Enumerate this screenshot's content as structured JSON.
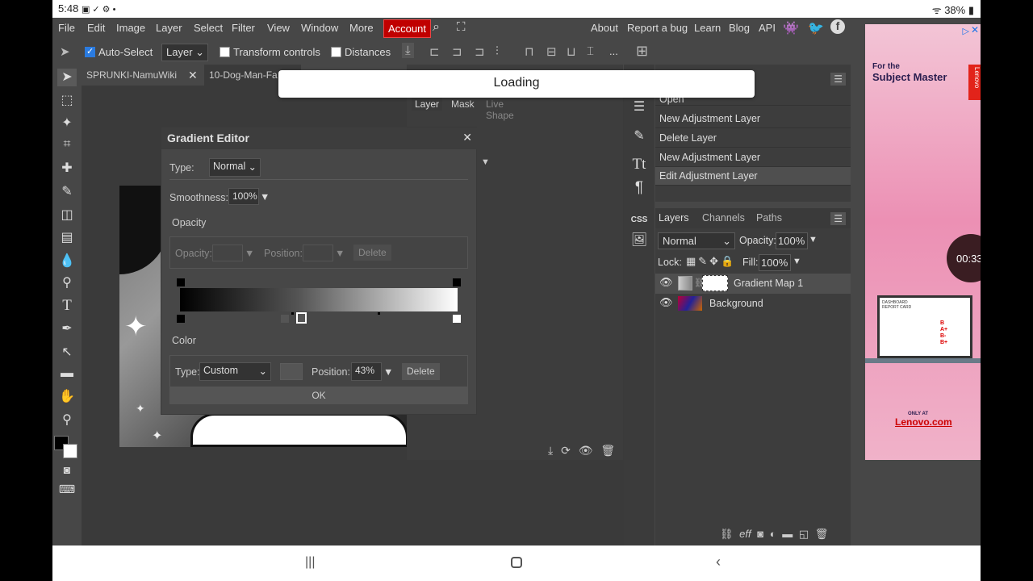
{
  "status": {
    "time": "5:48",
    "icons_left": "▣ ✓ ⚙ •",
    "battery": "38%"
  },
  "menu": {
    "file": "File",
    "edit": "Edit",
    "image": "Image",
    "layer": "Layer",
    "select": "Select",
    "filter": "Filter",
    "view": "View",
    "window": "Window",
    "more": "More",
    "account": "Account",
    "about": "About",
    "report": "Report a bug",
    "learn": "Learn",
    "blog": "Blog",
    "api": "API"
  },
  "options": {
    "auto_select": "Auto-Select",
    "layer_select": "Layer",
    "transform_controls": "Transform controls",
    "distances": "Distances",
    "more_dots": "..."
  },
  "tabs": {
    "tab1": "SPRUNKI-NamuWiki",
    "tab2": "10-Dog-Man-Fa"
  },
  "loading": "Loading",
  "mid_tabs": {
    "layer": "Layer",
    "mask": "Mask",
    "live_shape": "Live Shape"
  },
  "history": {
    "items": [
      "Open",
      "New Adjustment Layer",
      "Delete Layer",
      "New Adjustment Layer",
      "Edit Adjustment Layer"
    ]
  },
  "layers": {
    "tabs": [
      "Layers",
      "Channels",
      "Paths"
    ],
    "blend": "Normal",
    "opacity_label": "Opacity:",
    "opacity_value": "100%",
    "lock_label": "Lock:",
    "fill_label": "Fill:",
    "fill_value": "100%",
    "rows": [
      {
        "name": "Gradient Map 1"
      },
      {
        "name": "Background"
      }
    ],
    "footer_eff": "eff"
  },
  "gradient_editor": {
    "title": "Gradient Editor",
    "type_label": "Type:",
    "type_value": "Normal",
    "smoothness_label": "Smoothness:",
    "smoothness_value": "100%",
    "opacity_section": "Opacity",
    "opacity_label": "Opacity:",
    "position_label": "Position:",
    "delete": "Delete",
    "color_section": "Color",
    "color_type_label": "Type:",
    "color_type_value": "Custom",
    "color_position_label": "Position:",
    "color_position_value": "43%",
    "color_delete": "Delete",
    "ok": "OK"
  },
  "ad": {
    "for_the": "For the",
    "headline": "Subject Master",
    "brand": "Lenovo",
    "timer": "00:33",
    "only_at": "ONLY AT",
    "site": "Lenovo.com",
    "screen_title": "DASHBOARD",
    "screen_sub": "REPORT CARD",
    "grades": [
      "B",
      "A+",
      "B-",
      "B+"
    ]
  },
  "colors": {
    "accent": "#c00000",
    "panel": "#474747",
    "dark": "#3d3d3d"
  }
}
